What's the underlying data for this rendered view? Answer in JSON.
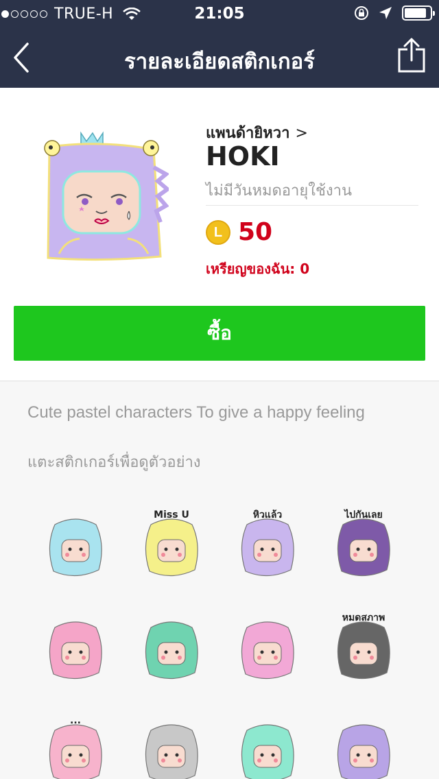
{
  "status_bar": {
    "carrier": "TRUE-H",
    "signal_dots": 1,
    "time": "21:05",
    "battery_level": 0.85
  },
  "nav": {
    "title": "รายละเอียดสติกเกอร์",
    "back_icon": "chevron-left-icon",
    "share_icon": "share-icon"
  },
  "product": {
    "author": "แพนด้ายิหวา",
    "author_chevron": ">",
    "name": "HOKI",
    "validity": "ไม่มีวันหมดอายุใช้งาน",
    "coin_symbol": "L",
    "price": "50",
    "my_coins": "เหรียญของฉัน: 0",
    "buy_label": "ซื้อ",
    "buy_color": "#1ec71e",
    "price_color": "#d0021b"
  },
  "description": "Cute pastel characters To give a happy feeling",
  "preview_hint": "แตะสติกเกอร์เพื่อดูตัวอย่าง",
  "stickers": [
    {
      "label": "",
      "color": "#a9e3ef"
    },
    {
      "label": "Miss U",
      "color": "#f5f08a"
    },
    {
      "label": "หิวแล้ว",
      "color": "#c9b6ee"
    },
    {
      "label": "ไปกันเลย",
      "color": "#7e5aa8"
    },
    {
      "label": "",
      "color": "#f5a5c8"
    },
    {
      "label": "",
      "color": "#6fd3b0"
    },
    {
      "label": "",
      "color": "#f2a8d6"
    },
    {
      "label": "หมดสภาพ",
      "color": "#666666"
    },
    {
      "label": "...",
      "color": "#f7b3cc"
    },
    {
      "label": "",
      "color": "#c8c8c8"
    },
    {
      "label": "",
      "color": "#8de8cf"
    },
    {
      "label": "",
      "color": "#b8a4e6"
    }
  ]
}
